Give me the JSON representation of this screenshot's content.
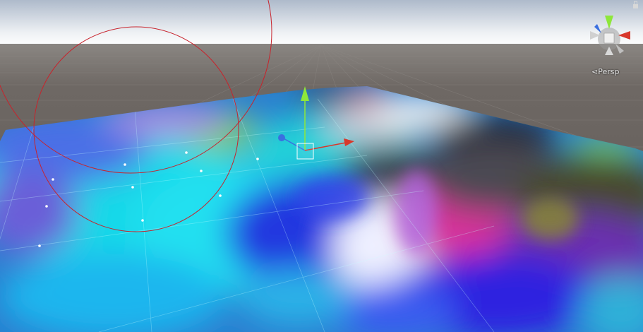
{
  "viewport": {
    "projection_label": "⋖Persp"
  },
  "gizmo": {
    "axes": [
      "x-axis",
      "y-axis",
      "z-axis"
    ],
    "colors": {
      "x": "#d8382c",
      "y": "#8ee73a",
      "z": "#3a6fe0"
    }
  },
  "colors": {
    "sky_top": "#b7c2cf",
    "sky_horizon": "#ffffff",
    "ground": "#6b6560",
    "gizmo_bg": "#9a9a9a",
    "brush_circle": "#c8232c"
  }
}
